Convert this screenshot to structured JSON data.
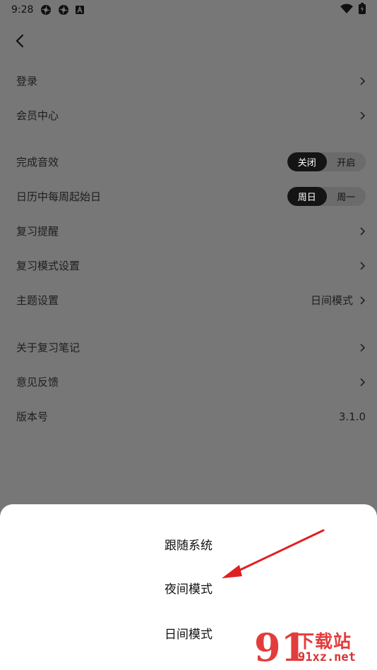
{
  "status_bar": {
    "time": "9:28"
  },
  "settings": {
    "login": "登录",
    "member_center": "会员中心",
    "completion_sound": {
      "label": "完成音效",
      "options": [
        "关闭",
        "开启"
      ],
      "selected": "关闭"
    },
    "week_start": {
      "label": "日历中每周起始日",
      "options": [
        "周日",
        "周一"
      ],
      "selected": "周日"
    },
    "review_reminder": "复习提醒",
    "review_mode_settings": "复习模式设置",
    "theme": {
      "label": "主题设置",
      "value": "日间模式"
    },
    "about": "关于复习笔记",
    "feedback": "意见反馈",
    "version": {
      "label": "版本号",
      "value": "3.1.0"
    }
  },
  "theme_sheet": {
    "options": [
      "跟随系统",
      "夜间模式",
      "日间模式"
    ]
  },
  "watermark": {
    "number": "91",
    "title": "下载站",
    "url": "91xz.net"
  },
  "colors": {
    "overlay_background": "#777777",
    "toggle_active": "#141414",
    "annotation_arrow": "#e02020",
    "watermark": "#e23c3c"
  }
}
